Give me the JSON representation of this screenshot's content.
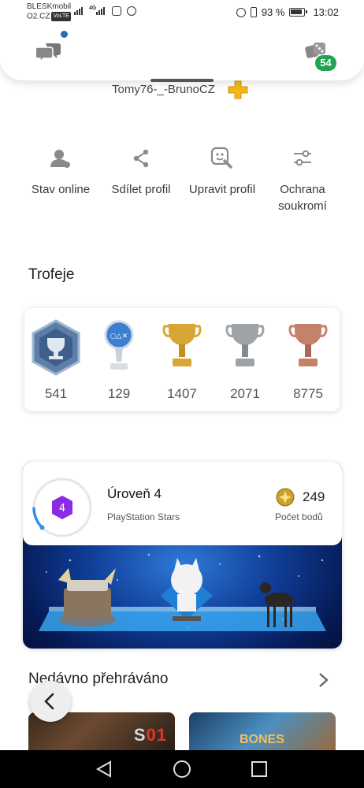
{
  "status_bar": {
    "carrier_line1": "BLESKmobil",
    "carrier_line2": "O2.CZ",
    "volte": "VoLTE",
    "network": "4G",
    "battery": "93 %",
    "time": "13:02"
  },
  "header": {
    "games_badge": "54",
    "username": "Tomy76-_-BrunoCZ"
  },
  "actions": [
    {
      "label": "Stav online",
      "icon": "person-status-icon"
    },
    {
      "label": "Sdílet profil",
      "icon": "share-icon"
    },
    {
      "label": "Upravit profil",
      "icon": "edit-profile-icon"
    },
    {
      "label": "Ochrana soukromí",
      "icon": "privacy-sliders-icon"
    }
  ],
  "trophies": {
    "title": "Trofeje",
    "level": "541",
    "platinum": "129",
    "gold": "1407",
    "silver": "2071",
    "bronze": "8775"
  },
  "stars": {
    "level_badge": "4",
    "level_title": "Úroveň 4",
    "subtitle": "PlayStation Stars",
    "points": "249",
    "points_label": "Počet bodů",
    "level_progress": 0.12
  },
  "recent": {
    "title": "Nedávno přehráváno",
    "tile1_text": "S",
    "tile1_accent": "01",
    "tile2_text": "BONES"
  },
  "colors": {
    "accent_blue": "#1d6fb8",
    "badge_green": "#23a455",
    "level_purple": "#8a2be2"
  }
}
